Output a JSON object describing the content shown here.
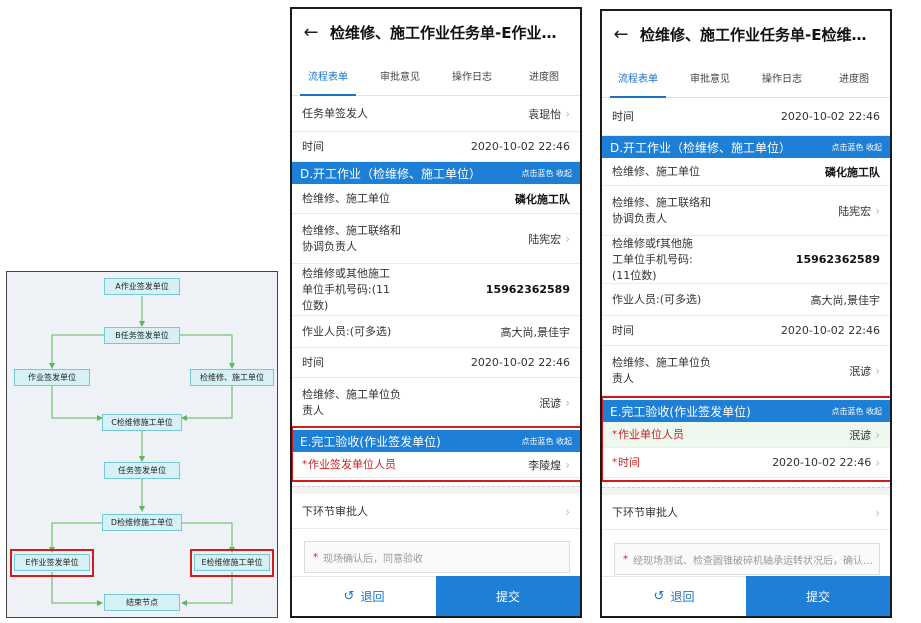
{
  "flowchart": {
    "nodes": [
      "A作业签发单位",
      "B任务签发单位",
      "作业签发单位",
      "检维修、施工单位",
      "C检维修施工单位",
      "任务签发单位",
      "D检维修施工单位",
      "E作业签发单位",
      "E检维修施工单位",
      "结束节点"
    ]
  },
  "phone_a": {
    "title": "检维修、施工作业任务单-E作业签...",
    "tabs": [
      "流程表单",
      "审批意见",
      "操作日志",
      "进度图"
    ],
    "rows_top": [
      {
        "label": "任务单签发人",
        "value": "袁琨怡"
      },
      {
        "label": "时间",
        "value": "2020-10-02 22:46"
      }
    ],
    "section_d": {
      "title": "D.开工作业（检维修、施工单位）",
      "action": "点击蓝色 收起"
    },
    "rows_d": [
      {
        "label": "检维修、施工单位",
        "value": "磷化施工队"
      },
      {
        "label": "检维修、施工联络和协调负责人",
        "value": "陆宪宏"
      },
      {
        "label": "检维修或其他施工单位手机号码:(11位数)",
        "value": "15962362589"
      },
      {
        "label": "作业人员:(可多选)",
        "value": "高大尚,景佳宇"
      },
      {
        "label": "时间",
        "value": "2020-10-02 22:46"
      },
      {
        "label": "检维修、施工单位负责人",
        "value": "泯谚"
      }
    ],
    "section_e": {
      "title": "E.完工验收(作业签发单位)",
      "action": "点击蓝色 收起"
    },
    "rows_e": [
      {
        "label": "作业签发单位人员",
        "value": "李陵煌"
      }
    ],
    "next_approver": "下环节审批人",
    "input_placeholder": "现场确认后，同意验收",
    "btn_retreat": "退回",
    "btn_submit": "提交"
  },
  "phone_b": {
    "title": "检维修、施工作业任务单-E检维修...",
    "tabs": [
      "流程表单",
      "审批意见",
      "操作日志",
      "进度图"
    ],
    "rows_top": [
      {
        "label": "时间",
        "value": "2020-10-02 22:46"
      }
    ],
    "section_d": {
      "title": "D.开工作业（检维修、施工单位）",
      "action": "点击蓝色 收起"
    },
    "rows_d": [
      {
        "label": "检维修、施工单位",
        "value": "磷化施工队"
      },
      {
        "label": "检维修、施工联络和协调负责人",
        "value": "陆宪宏"
      },
      {
        "label": "检维修或f其他施工单位手机号码:(11位数)",
        "value": "15962362589"
      },
      {
        "label": "作业人员:(可多选)",
        "value": "高大尚,景佳宇"
      },
      {
        "label": "时间",
        "value": "2020-10-02 22:46"
      },
      {
        "label": "检维修、施工单位负责人",
        "value": "泯谚"
      }
    ],
    "section_e": {
      "title": "E.完工验收(作业签发单位)",
      "action": "点击蓝色 收起"
    },
    "rows_e": [
      {
        "label": "作业单位人员",
        "value": "泯谚"
      },
      {
        "label": "时间",
        "value": "2020-10-02 22:46"
      }
    ],
    "next_approver": "下环节审批人",
    "input_placeholder": "经现场测试、检查圆锥破碎机轴承运转状况后，确认…",
    "btn_retreat": "退回",
    "btn_submit": "提交"
  },
  "colors": {
    "accent": "#1e7fd6",
    "highlight": "#d21c1c",
    "node_fill": "#d6f1f6",
    "arrow": "#5cb85c"
  }
}
